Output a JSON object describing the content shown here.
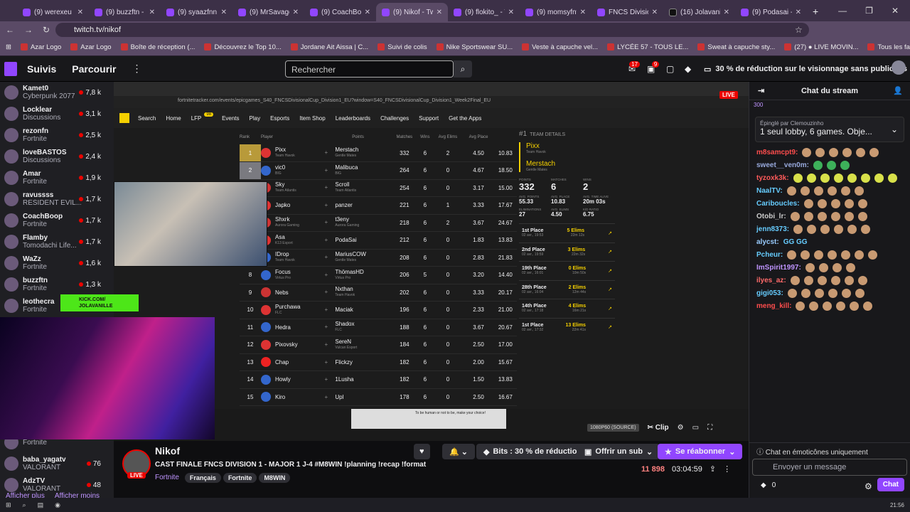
{
  "browser": {
    "tabs": [
      {
        "label": "(9) werexeu - T"
      },
      {
        "label": "(9) buzzftn - Tw"
      },
      {
        "label": "(9) syaazfnn -"
      },
      {
        "label": "(9) MrSavage"
      },
      {
        "label": "(9) CoachBoop"
      },
      {
        "label": "(9) Nikof - Twi"
      },
      {
        "label": "(9) flokito_ - Tw"
      },
      {
        "label": "(9) momsyfnv2"
      },
      {
        "label": "FNCS Division"
      },
      {
        "label": "(16) Jolavanille"
      },
      {
        "label": "(9) Podasai - Tw"
      }
    ],
    "url": "twitch.tv/nikof",
    "bookmarks": [
      "Azar Logo",
      "Azar Logo",
      "Boîte de réception (...",
      "Découvrez le Top 10...",
      "Jordane Ait Aissa | C...",
      "Suivi de colis",
      "Nike Sportswear SU...",
      "Veste à capuche vel...",
      "LYCÉE 57 - TOUS LE...",
      "Sweat à capuche sty...",
      "(27) ● LIVE MOVIN...",
      "Tous les favoris"
    ]
  },
  "header": {
    "nav_following": "Suivis",
    "nav_browse": "Parcourir",
    "search_placeholder": "Rechercher",
    "notif_count": "17",
    "inbox_count": "9",
    "promo": "30 % de réduction sur le visionnage sans publicités"
  },
  "sidebar": {
    "channels": [
      {
        "name": "Kamet0",
        "game": "Cyberpunk 2077",
        "viewers": "7,8 k"
      },
      {
        "name": "Locklear",
        "game": "Discussions",
        "viewers": "3,1 k"
      },
      {
        "name": "rezonfn",
        "game": "Fortnite",
        "viewers": "2,5 k"
      },
      {
        "name": "loveBASTOS",
        "game": "Discussions",
        "viewers": "2,4 k"
      },
      {
        "name": "Amar",
        "game": "Fortnite",
        "viewers": "1,9 k"
      },
      {
        "name": "ravussss",
        "game": "RESIDENT EVIL...",
        "viewers": "1,7 k"
      },
      {
        "name": "CoachBoop",
        "game": "Fortnite",
        "viewers": "1,7 k"
      },
      {
        "name": "Flamby",
        "game": "Tomodachi Life...",
        "viewers": "1,7 k"
      },
      {
        "name": "WaZz",
        "game": "Fortnite",
        "viewers": "1,6 k"
      },
      {
        "name": "buzzftn",
        "game": "Fortnite",
        "viewers": "1,3 k"
      },
      {
        "name": "leothecra",
        "game": "Fortnite",
        "viewers": ""
      }
    ],
    "extra": [
      {
        "name": "",
        "game": "Fortnite",
        "viewers": ""
      },
      {
        "name": "baba_yagatv",
        "game": "VALORANT",
        "viewers": "76"
      },
      {
        "name": "AdzTV",
        "game": "VALORANT",
        "viewers": "48"
      }
    ],
    "show_more": "Afficher plus",
    "show_less": "Afficher moins"
  },
  "stream": {
    "live_label": "LIVE",
    "inner_url": "fortnitetracker.com/events/epicgames_S40_FNCSDivisionalCup_Division1_EU?window=S40_FNCSDivisionalCup_Division1_Week2Final_EU",
    "ft_nav": [
      "Search",
      "Home",
      "LFP",
      "Events",
      "Play",
      "Esports",
      "Item Shop",
      "Leaderboards",
      "Challenges",
      "Support",
      "Get the Apps"
    ],
    "lfp_badge": "98",
    "col_headers": [
      "Rank",
      "Player",
      "",
      "Points",
      "Matches",
      "Wins",
      "Avg Elims",
      "Avg Place"
    ],
    "rows": [
      {
        "rank": "1",
        "p1": "Pixx",
        "t1": "Team Havok",
        "p2": "Merstach",
        "t2": "Gentle Mates",
        "points": "332",
        "matches": "6",
        "wins": "2",
        "elims": "4.50",
        "place": "10.83"
      },
      {
        "rank": "2",
        "p1": "vic0",
        "t1": "BIG",
        "p2": "Malibuca",
        "t2": "BIG",
        "points": "264",
        "matches": "6",
        "wins": "0",
        "elims": "4.67",
        "place": "18.50"
      },
      {
        "rank": "3",
        "p1": "Sky",
        "t1": "Team Atlantis",
        "p2": "Scroll",
        "t2": "Team Atlantis",
        "points": "254",
        "matches": "6",
        "wins": "0",
        "elims": "3.17",
        "place": "15.00"
      },
      {
        "rank": "4",
        "p1": "Japko",
        "t1": "",
        "p2": "panzer",
        "t2": "",
        "points": "221",
        "matches": "6",
        "wins": "1",
        "elims": "3.33",
        "place": "17.67"
      },
      {
        "rank": "5",
        "p1": "Shxrk",
        "t1": "Aurora Gaming",
        "p2": "t3eny",
        "t2": "Aurora Gaming",
        "points": "218",
        "matches": "6",
        "wins": "2",
        "elims": "3.67",
        "place": "24.67"
      },
      {
        "rank": "6",
        "p1": "Asa",
        "t1": "K13 Esport",
        "p2": "PodaSai",
        "t2": "",
        "points": "212",
        "matches": "6",
        "wins": "0",
        "elims": "1.83",
        "place": "13.83"
      },
      {
        "rank": "7",
        "p1": "IDrop",
        "t1": "Team Havok",
        "p2": "MariusCOW",
        "t2": "Gentle Mates",
        "points": "208",
        "matches": "6",
        "wins": "0",
        "elims": "2.83",
        "place": "21.83"
      },
      {
        "rank": "8",
        "p1": "Focus",
        "t1": "Virtus Pro",
        "p2": "ThömasHD",
        "t2": "Virtus Pro",
        "points": "206",
        "matches": "5",
        "wins": "0",
        "elims": "3.20",
        "place": "14.40"
      },
      {
        "rank": "9",
        "p1": "Nebs",
        "t1": "",
        "p2": "Nxthan",
        "t2": "Team Havok",
        "points": "202",
        "matches": "6",
        "wins": "0",
        "elims": "3.33",
        "place": "20.17"
      },
      {
        "rank": "10",
        "p1": "Purchawa",
        "t1": "FLC",
        "p2": "Maciak",
        "t2": "",
        "points": "196",
        "matches": "6",
        "wins": "0",
        "elims": "2.33",
        "place": "21.00"
      },
      {
        "rank": "11",
        "p1": "Hedra",
        "t1": "",
        "p2": "Shadox",
        "t2": "FLC",
        "points": "188",
        "matches": "6",
        "wins": "0",
        "elims": "3.67",
        "place": "20.67"
      },
      {
        "rank": "12",
        "p1": "Pixovsky",
        "t1": "",
        "p2": "SereN",
        "t2": "Vulcan Esport",
        "points": "184",
        "matches": "6",
        "wins": "0",
        "elims": "2.50",
        "place": "17.00"
      },
      {
        "rank": "13",
        "p1": "Chap",
        "t1": "",
        "p2": "Flickzy",
        "t2": "",
        "points": "182",
        "matches": "6",
        "wins": "0",
        "elims": "2.00",
        "place": "15.67"
      },
      {
        "rank": "14",
        "p1": "Howly",
        "t1": "",
        "p2": "1Lusha",
        "t2": "",
        "points": "182",
        "matches": "6",
        "wins": "0",
        "elims": "1.50",
        "place": "13.83"
      },
      {
        "rank": "15",
        "p1": "Kiro",
        "t1": "",
        "p2": "Upl",
        "t2": "",
        "points": "178",
        "matches": "6",
        "wins": "0",
        "elims": "2.50",
        "place": "16.67"
      }
    ],
    "details": {
      "rank": "#1",
      "title": "TEAM DETAILS",
      "p1": "Pixx",
      "t1": "Team Havok",
      "p2": "Merstach",
      "t2": "Gentle Mates",
      "stats": [
        {
          "k": "POINTS",
          "v": "332"
        },
        {
          "k": "MATCHES",
          "v": "6"
        },
        {
          "k": "WINS",
          "v": "2"
        },
        {
          "k": "AVG. POINTS",
          "v": "55.33"
        },
        {
          "k": "AVG. PLACE",
          "v": "10.83"
        },
        {
          "k": "AVG. TIME ALIVE",
          "v": "20m 03s"
        },
        {
          "k": "ELIMINATIONS",
          "v": "27"
        },
        {
          "k": "AVG. ELIMS",
          "v": "4.50"
        },
        {
          "k": "K/D RATIO",
          "v": "6.75"
        }
      ],
      "matches": [
        {
          "place": "1st Place",
          "date": "02 avr., 19:53",
          "elims": "5 Elims",
          "time": "22m 12s"
        },
        {
          "place": "2nd Place",
          "date": "02 avr., 19:59",
          "elims": "3 Elims",
          "time": "22m 32s"
        },
        {
          "place": "19th Place",
          "date": "02 avr., 16:01",
          "elims": "0 Elims",
          "time": "10m 50s"
        },
        {
          "place": "28th Place",
          "date": "02 avr., 16:04",
          "elims": "2 Elims",
          "time": "12m 44s"
        },
        {
          "place": "14th Place",
          "date": "02 avr., 17:18",
          "elims": "4 Elims",
          "time": "16m 21s"
        },
        {
          "place": "1st Place",
          "date": "02 avr., 17:32",
          "elims": "13 Elims",
          "time": "22m 41s"
        }
      ]
    },
    "kick_line1": "KICK.COM/",
    "kick_line2": "JOLAVANILLE",
    "captcha": "To be human or not to be, make your choice!",
    "quality": "1080P60 (SOURCE)",
    "clip": "Clip"
  },
  "channel_info": {
    "name": "Nikof",
    "live": "LIVE",
    "title": "CAST FINALE FNCS DIVISION 1 - MAJOR 1 J-4 #M8WIN !planning !recap !format",
    "game": "Fortnite",
    "tags": [
      "Français",
      "Fortnite",
      "M8WIN"
    ],
    "bits": "Bits : 30 % de réduction",
    "offer_sub": "Offrir un sub",
    "resub": "Se réabonner",
    "viewers": "11 898",
    "uptime": "03:04:59"
  },
  "chat": {
    "title": "Chat du stream",
    "top_count": "300",
    "pinned_by": "Épinglé par Clemouzinho",
    "pinned_msg": "1 seul lobby, 6 games. Obje...",
    "messages": [
      {
        "user": "m8samcpt9:",
        "emotes": 6
      },
      {
        "user": "sweet__ven0m:",
        "emotes": 3
      },
      {
        "user": "tyzoxk3k:",
        "emotes": 8
      },
      {
        "user": "NaalTV:",
        "emotes": 6
      },
      {
        "user": "Cariboucles:",
        "emotes": 5
      },
      {
        "user": "Otobi_lr:",
        "emotes": 6
      },
      {
        "user": "jenn8373:",
        "emotes": 6
      },
      {
        "user": "alycst:",
        "emotes": 0,
        "text": "GG GG"
      },
      {
        "user": "Pcheur:",
        "emotes": 7
      },
      {
        "user": "ImSpirit1997:",
        "emotes": 4
      },
      {
        "user": "ilyes_az:",
        "emotes": 6
      },
      {
        "user": "gigi053:",
        "emotes": 6
      },
      {
        "user": "meng_kill:",
        "emotes": 6
      }
    ],
    "emote_only": "Chat en émoticônes uniquement",
    "input_placeholder": "Envoyer un message",
    "points": "0",
    "send": "Chat"
  },
  "taskbar": {
    "time": "21:56"
  }
}
